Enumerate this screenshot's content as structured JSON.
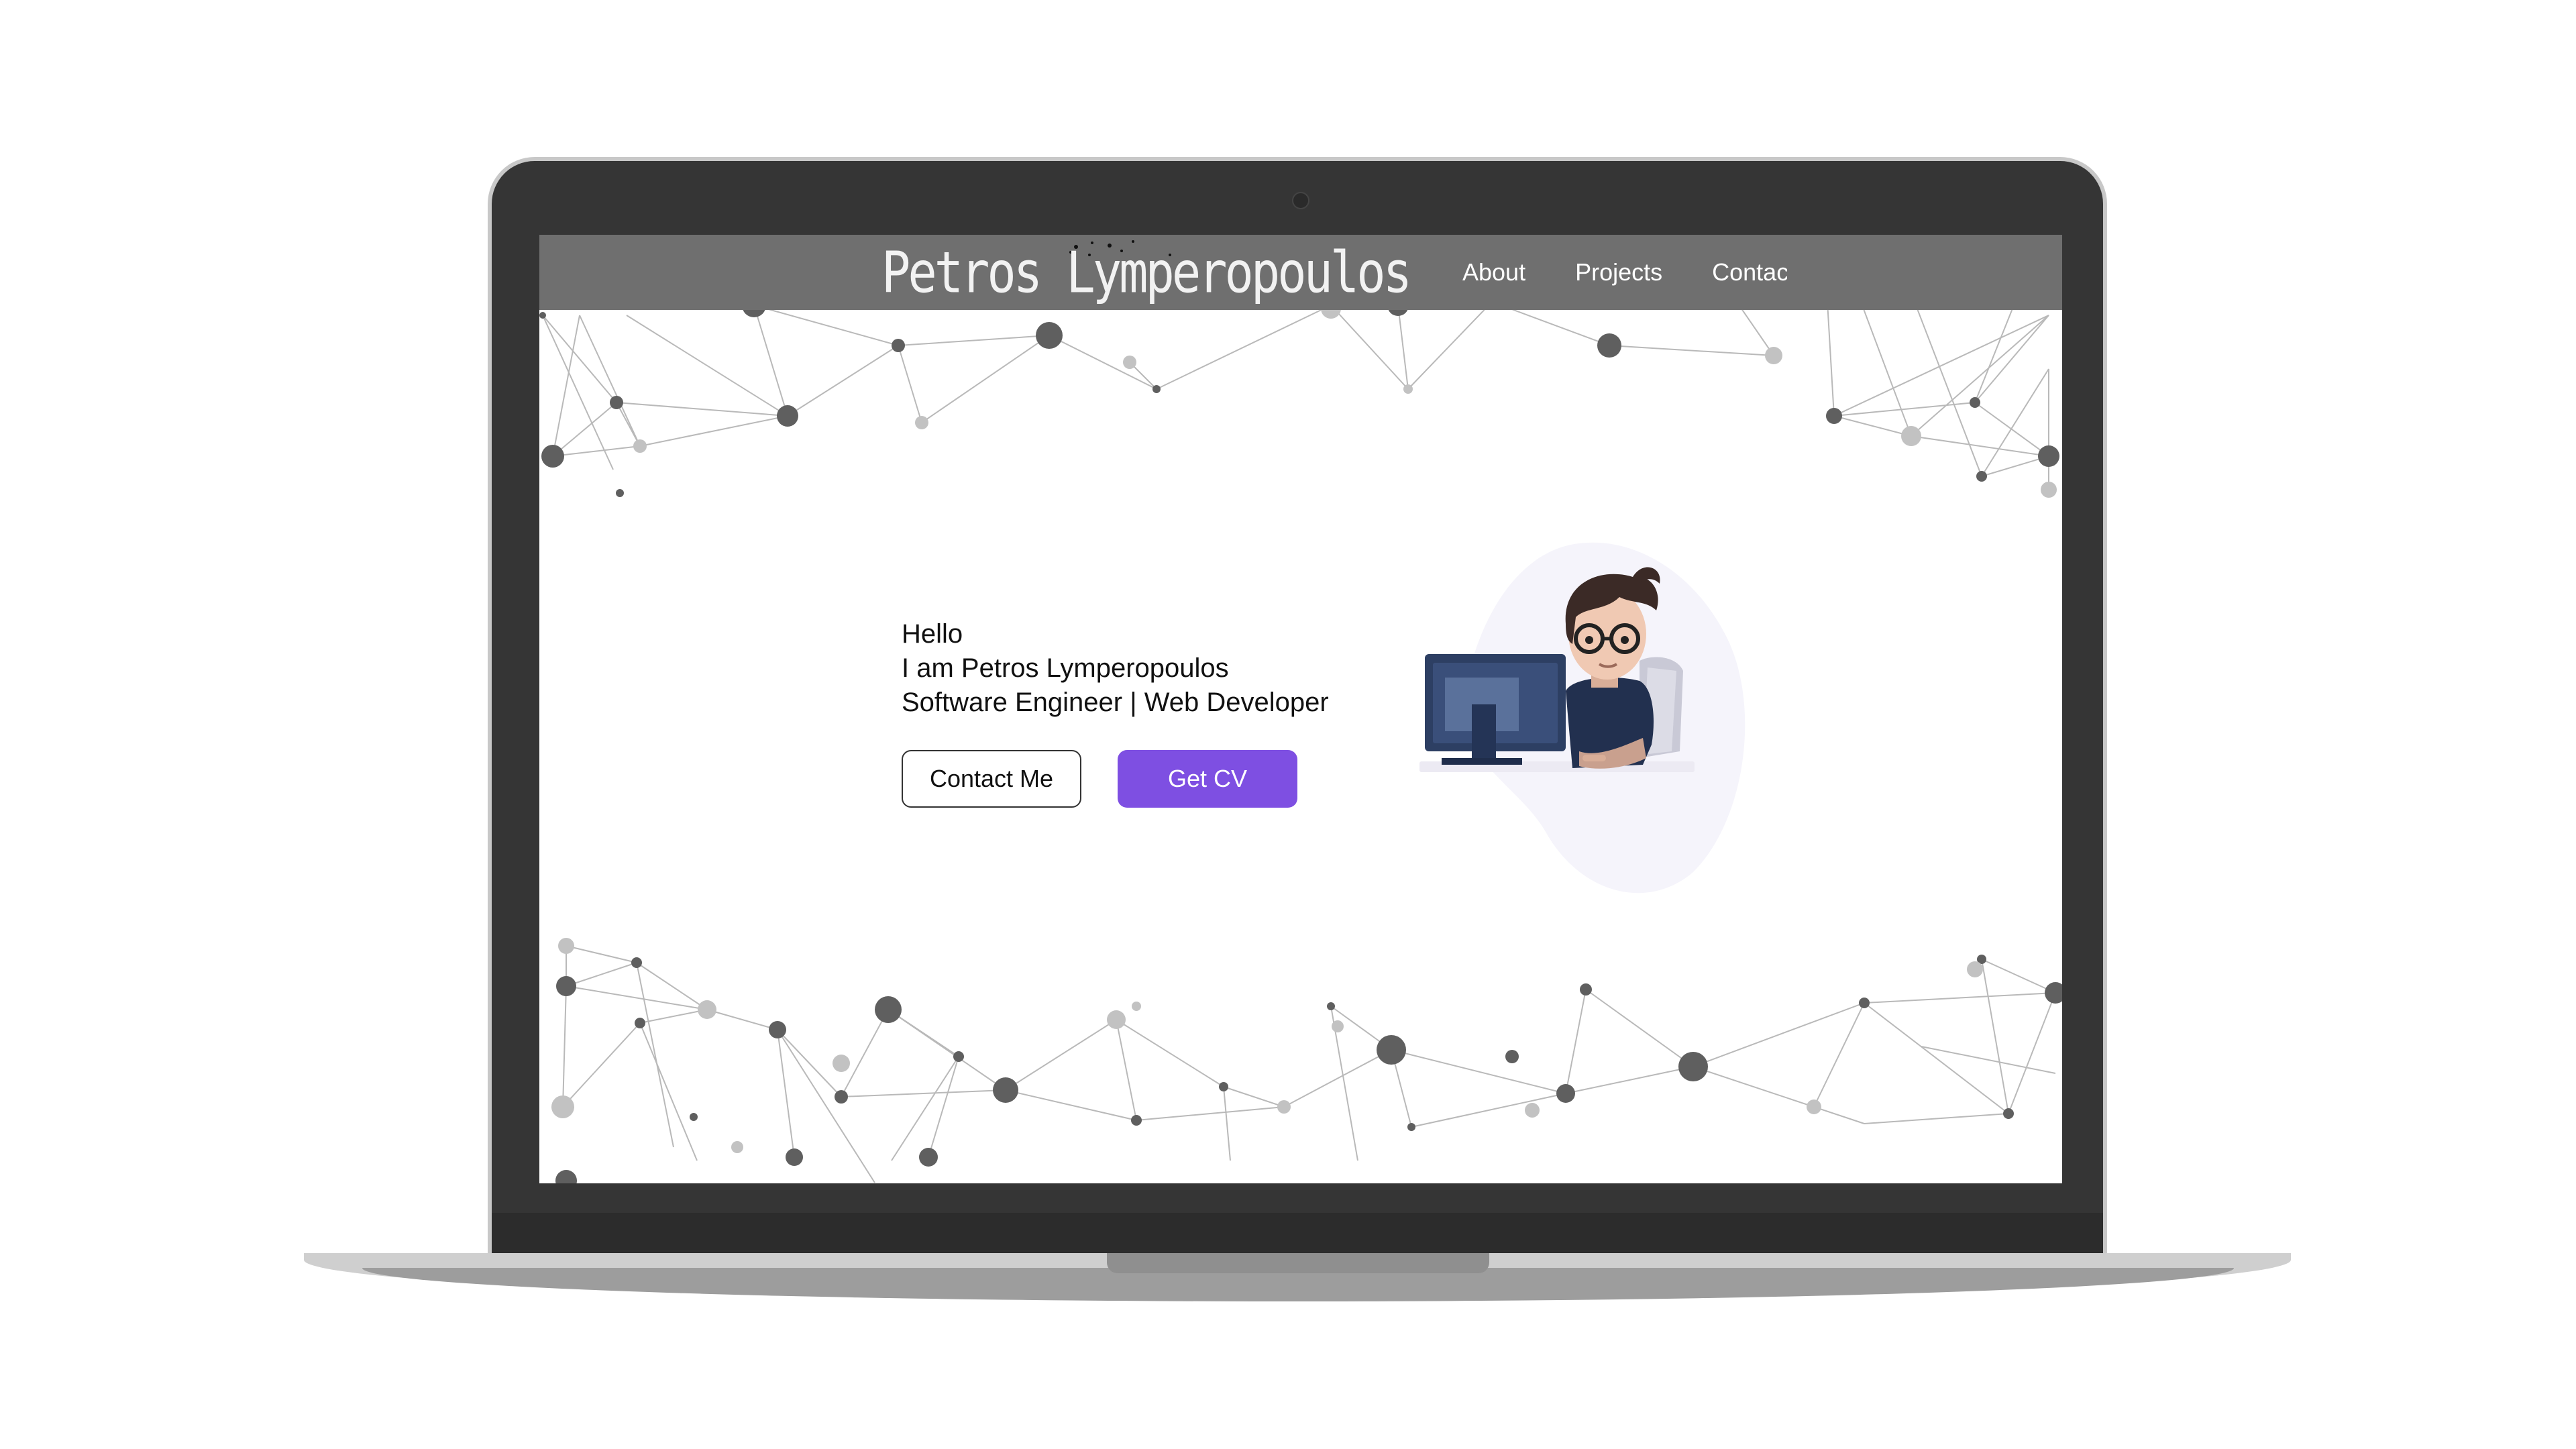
{
  "site": {
    "brand": "Petros Lymperopoulos",
    "nav": [
      {
        "label": "About"
      },
      {
        "label": "Projects"
      },
      {
        "label": "Contac"
      }
    ]
  },
  "hero": {
    "greeting": "Hello",
    "intro": "I am Petros Lymperopoulos",
    "role": "Software Engineer | Web Developer",
    "contact_button": "Contact Me",
    "cv_button": "Get CV",
    "illustration": "developer-at-computer-illustration"
  },
  "colors": {
    "navbar": "#6f6f6f",
    "accent": "#7e4fe2",
    "laptop_frame": "#353535"
  }
}
